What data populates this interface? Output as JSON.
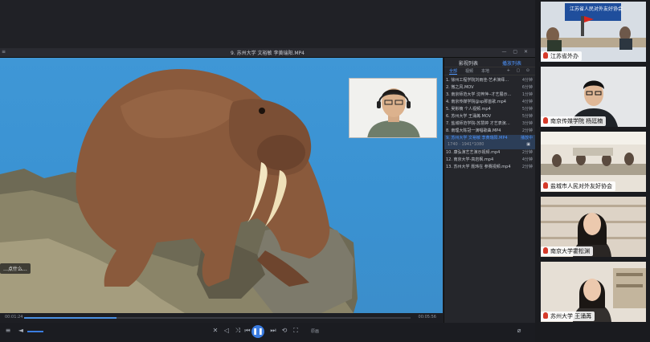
{
  "window": {
    "title": "9. 苏州大学 文裕敏 李黄瑞阳.MP4",
    "menu_glyph": "≡",
    "controls": "— ▢ ✕"
  },
  "video": {
    "subtitle": "…点什么..."
  },
  "seek": {
    "elapsed": "00:01:24",
    "total": "00:05:56",
    "progress": 0.24
  },
  "controls": {
    "icons": [
      "≡",
      "◄",
      "✕",
      "◁",
      "⤨",
      "⟲",
      "⏮",
      "⏭",
      "⛶",
      "⌀"
    ],
    "play_glyph": "❚❚",
    "quality": "原画"
  },
  "playlist": {
    "tab_list": "影视列表",
    "tab_history": "播放列表",
    "sub_tabs": [
      "全部",
      "视频",
      "本地"
    ],
    "tool_icons": "+ ▢ ⊙",
    "items": [
      {
        "name": "1. 徐州工程学院刘雨佳-艺术演绎…",
        "dur": "4分钟"
      },
      {
        "name": "2. 微之风.MOV",
        "dur": "6分钟"
      },
      {
        "name": "3. 南京师范大学 沈梓萍--才艺展示…",
        "dur": "1分钟"
      },
      {
        "name": "4. 南京传媒学院@sp那首歌.mp4",
        "dur": "4分钟"
      },
      {
        "name": "5. 吴彬楠 个人视频.mp4",
        "dur": "5分钟"
      },
      {
        "name": "6. 苏州大学 王涌苒.MOV",
        "dur": "5分钟"
      },
      {
        "name": "7. 盐城师范学院-苏慧婷 才艺表演…",
        "dur": "3分钟"
      },
      {
        "name": "8. 南理大陈冠一演唱歌曲.MP4",
        "dur": "2分钟"
      },
      {
        "name": "9. 苏州大学 文裕敏 李黄瑞阳.MP4",
        "dur": "播放中"
      },
      {
        "name": "10. 康弘演艺艺演示视频.mp4",
        "dur": "2分钟"
      },
      {
        "name": "12. 南京大学-高岩枫.mp4",
        "dur": "4分钟"
      },
      {
        "name": "13. 苏州大学 聂玮在 参赛视频.mp4",
        "dur": "2分钟"
      }
    ],
    "current_meta": "1740 · 1941*1080",
    "current_icon": "▣"
  },
  "gallery": {
    "tiles": [
      {
        "name": "江苏省外办",
        "top_text": "江苏省人民对外友好协会"
      },
      {
        "name": "南京传媒学院 杨廷楠"
      },
      {
        "name": "盐城市人民对外友好协会"
      },
      {
        "name": "南京大学霍松渊"
      },
      {
        "name": "苏州大学 王涌苒"
      }
    ]
  },
  "colors": {
    "accent": "#4e95ff",
    "sky": "#3d95d5",
    "walrus": "#8a5a3c",
    "tusk": "#f3e6c2"
  }
}
